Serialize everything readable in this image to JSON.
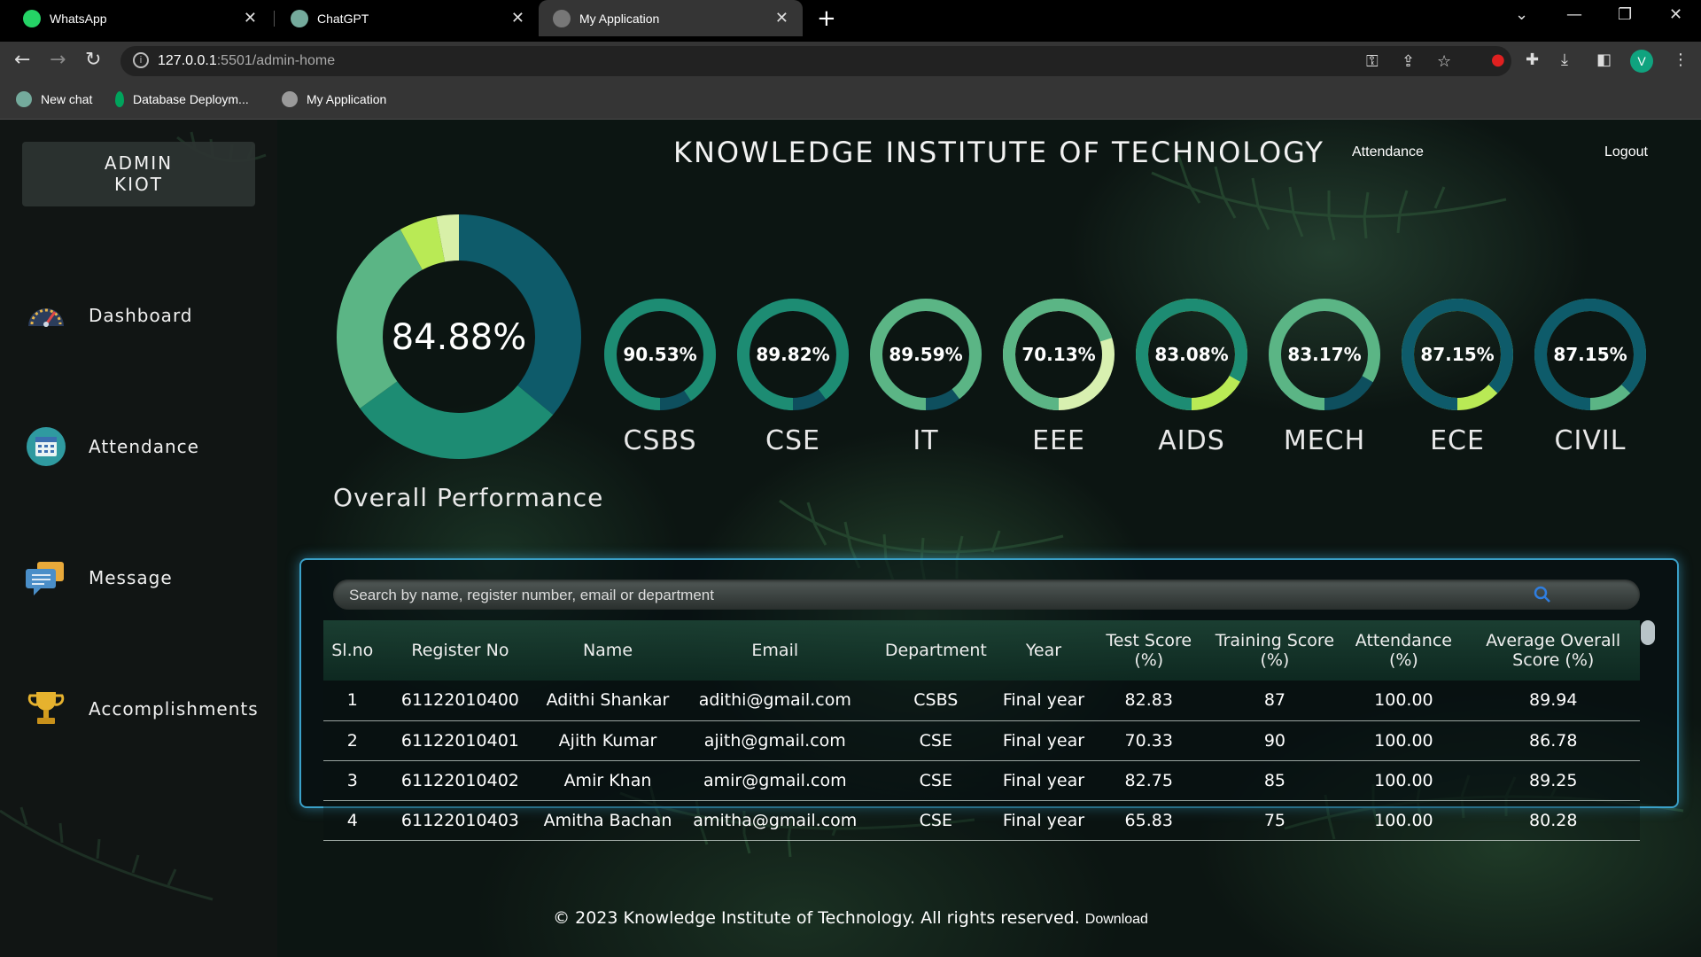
{
  "browser": {
    "tabs": [
      {
        "title": "WhatsApp",
        "color": "#25d366"
      },
      {
        "title": "ChatGPT",
        "color": "#74aa9c"
      },
      {
        "title": "My Application",
        "color": "#777777"
      }
    ],
    "url_host": "127.0.0.1",
    "url_rest": ":5501/admin-home",
    "profile_initial": "V",
    "bookmarks": [
      {
        "label": "New chat",
        "color": "#74aa9c"
      },
      {
        "label": "Database Deploym...",
        "color": "#00a35c"
      },
      {
        "label": "My Application",
        "color": "#9a9a9a"
      }
    ]
  },
  "sidebar": {
    "brand_line1": "ADMIN",
    "brand_line2": "KIOT",
    "items": [
      {
        "label": "Dashboard",
        "icon": "speedometer-icon"
      },
      {
        "label": "Attendance",
        "icon": "calendar-icon"
      },
      {
        "label": "Message",
        "icon": "chat-bubble-icon"
      },
      {
        "label": "Accomplishments",
        "icon": "trophy-icon"
      }
    ]
  },
  "header": {
    "title": "KNOWLEDGE INSTITUTE OF TECHNOLOGY",
    "attendance_link": "Attendance",
    "logout_link": "Logout"
  },
  "overall": {
    "value": "84.88%",
    "label": "Overall Performance",
    "segments": [
      {
        "fraction": 0.36,
        "color": "#0e5b6a"
      },
      {
        "fraction": 0.29,
        "color": "#1d8c73"
      },
      {
        "fraction": 0.27,
        "color": "#5bb585"
      },
      {
        "fraction": 0.05,
        "color": "#b9ea55"
      },
      {
        "fraction": 0.03,
        "color": "#d8f0a8"
      }
    ]
  },
  "departments": [
    {
      "name": "CSBS",
      "value": "90.53%",
      "percent": 90.53,
      "color": "#1d8c73",
      "track": "#0e4f5e"
    },
    {
      "name": "CSE",
      "value": "89.82%",
      "percent": 89.82,
      "color": "#1d8c73",
      "track": "#0e4f5e"
    },
    {
      "name": "IT",
      "value": "89.59%",
      "percent": 89.59,
      "color": "#5bb585",
      "track": "#0e4f5e"
    },
    {
      "name": "EEE",
      "value": "70.13%",
      "percent": 70.13,
      "color": "#5bb585",
      "track": "#d8f0b0"
    },
    {
      "name": "AIDS",
      "value": "83.08%",
      "percent": 83.08,
      "color": "#1d8c73",
      "track": "#b9ea55"
    },
    {
      "name": "MECH",
      "value": "83.17%",
      "percent": 83.17,
      "color": "#5bb585",
      "track": "#0e4f5e"
    },
    {
      "name": "ECE",
      "value": "87.15%",
      "percent": 87.15,
      "color": "#0e5b6a",
      "track": "#b9ea55"
    },
    {
      "name": "CIVIL",
      "value": "87.15%",
      "percent": 87.15,
      "color": "#0e5b6a",
      "track": "#5bb585"
    }
  ],
  "search": {
    "placeholder": "Search by name, register number, email or department"
  },
  "table": {
    "headers": [
      "Sl.no",
      "Register No",
      "Name",
      "Email",
      "Department",
      "Year",
      "Test Score (%)",
      "Training Score (%)",
      "Attendance (%)",
      "Average Overall Score (%)"
    ],
    "rows": [
      [
        "1",
        "61122010400",
        "Adithi Shankar",
        "adithi@gmail.com",
        "CSBS",
        "Final year",
        "82.83",
        "87",
        "100.00",
        "89.94"
      ],
      [
        "2",
        "61122010401",
        "Ajith Kumar",
        "ajith@gmail.com",
        "CSE",
        "Final year",
        "70.33",
        "90",
        "100.00",
        "86.78"
      ],
      [
        "3",
        "61122010402",
        "Amir Khan",
        "amir@gmail.com",
        "CSE",
        "Final year",
        "82.75",
        "85",
        "100.00",
        "89.25"
      ],
      [
        "4",
        "61122010403",
        "Amitha Bachan",
        "amitha@gmail.com",
        "CSE",
        "Final year",
        "65.83",
        "75",
        "100.00",
        "80.28"
      ]
    ]
  },
  "footer": {
    "text": "© 2023 Knowledge Institute of Technology. All rights reserved.",
    "download": "Download"
  }
}
